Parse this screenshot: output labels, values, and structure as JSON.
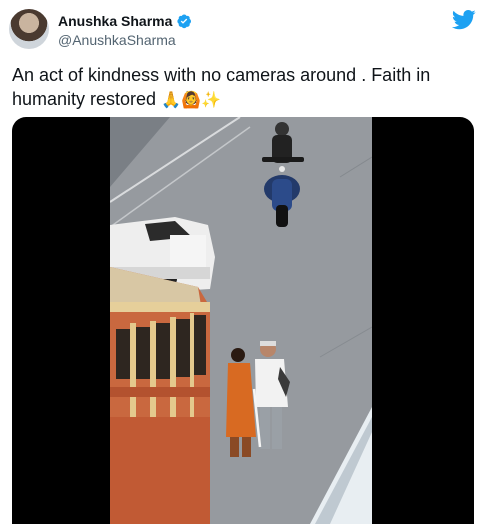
{
  "author": {
    "display_name": "Anushka Sharma",
    "handle": "@AnushkaSharma",
    "verified_icon": "verified-badge-icon",
    "avatar_icon": "avatar"
  },
  "brand": {
    "icon": "twitter-bird-icon",
    "color": "#1DA1F2"
  },
  "tweet": {
    "text": "An act of kindness with no cameras around . Faith in humanity restored",
    "emojis": "🙏🙆✨"
  },
  "media": {
    "type": "video",
    "icon": "video-thumbnail"
  },
  "colors": {
    "text": "#0f1419",
    "muted": "#536471",
    "accent": "#1DA1F2"
  }
}
